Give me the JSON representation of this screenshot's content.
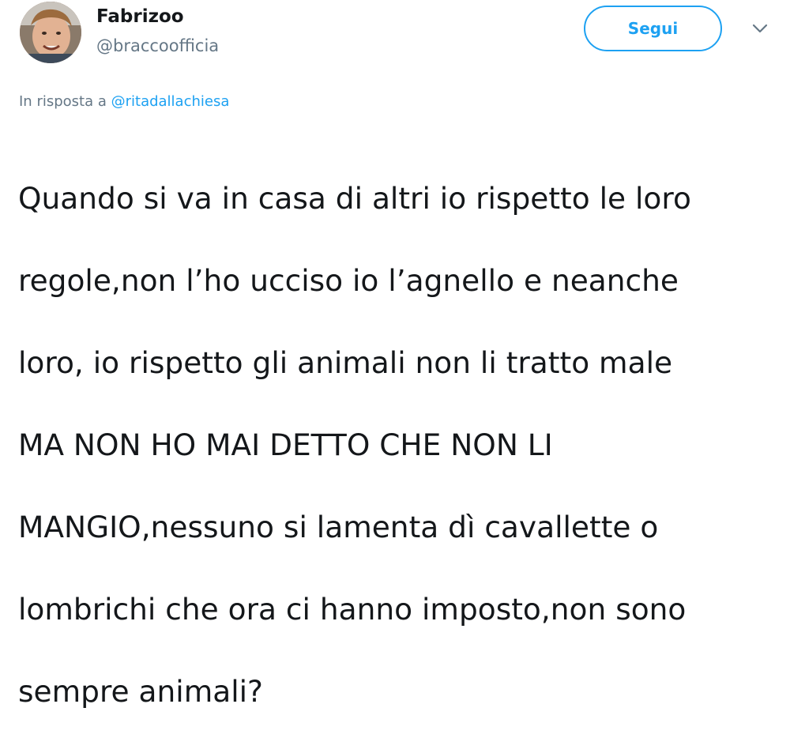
{
  "user": {
    "display_name": "Fabrizoo",
    "handle": "@braccoofficia"
  },
  "follow_button_label": "Segui",
  "icons": {
    "menu": "chevron-down-icon",
    "avatar": "profile-photo"
  },
  "reply": {
    "prefix": "In risposta a",
    "mention": "@ritadallachiesa"
  },
  "tweet_lines": [
    "Quando si va in casa di altri io rispetto le loro",
    "regole,non l’ho ucciso io l’agnello e neanche",
    "loro, io rispetto gli animali non li tratto male",
    "MA NON HO MAI DETTO CHE NON LI",
    "MANGIO,nessuno si lamenta dì cavallette o",
    "lombrichi che ora ci hanno imposto,non sono",
    "sempre animali?"
  ],
  "colors": {
    "accent": "#1da1f2",
    "secondary_text": "#657786",
    "primary_text": "#14171a"
  }
}
